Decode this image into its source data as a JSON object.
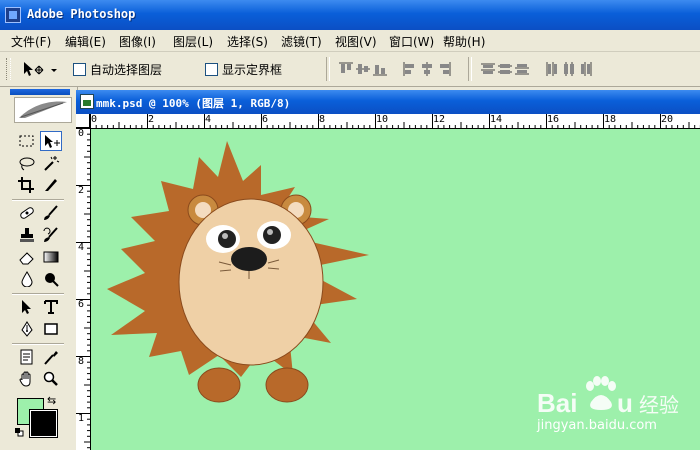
{
  "window": {
    "title": "Adobe Photoshop"
  },
  "menu": [
    "文件(F)",
    "编辑(E)",
    "图像(I)",
    "图层(L)",
    "选择(S)",
    "滤镜(T)",
    "视图(V)",
    "窗口(W)",
    "帮助(H)"
  ],
  "options": {
    "auto_select": "自动选择图层",
    "show_bounds": "显示定界框"
  },
  "document": {
    "title": "mmk.psd @ 100% (图层 1, RGB/8)",
    "ruler_h": [
      "0",
      "2",
      "4",
      "6",
      "8",
      "10",
      "12",
      "14",
      "16",
      "18",
      "20"
    ],
    "ruler_v": [
      "0",
      "2",
      "4",
      "6",
      "8",
      "1"
    ],
    "canvas_color": "#9df0ab"
  },
  "colors": {
    "foreground": "#9df0ab",
    "background": "#000000",
    "title_blue": "#0a5fd9"
  },
  "watermark": {
    "logo": "Baidu经验",
    "url": "jingyan.baidu.com"
  }
}
